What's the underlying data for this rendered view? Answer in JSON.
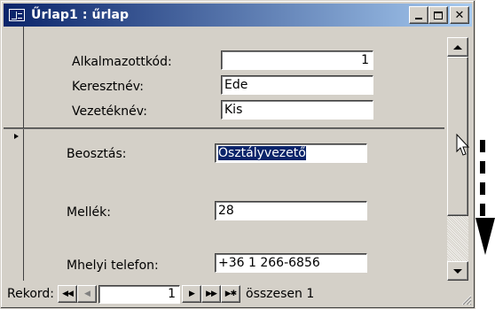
{
  "window": {
    "title": "Űrlap1 : űrlap"
  },
  "fields": [
    {
      "label": "Alkalmazottkód:",
      "value": "1"
    },
    {
      "label": "Keresztnév:",
      "value": "Ede"
    },
    {
      "label": "Vezetéknév:",
      "value": "Kis"
    },
    {
      "label": "Beosztás:",
      "value": "Osztályvezető"
    },
    {
      "label": "Mellék:",
      "value": "28"
    },
    {
      "label": "Mhelyi telefon:",
      "value": "+36 1 266-6856"
    }
  ],
  "navigation": {
    "label": "Rekord:",
    "current": "1",
    "count_text": "összesen 1",
    "first": "◀◀",
    "prev": "◀",
    "next": "▶",
    "last": "▶▶",
    "new": "▶✱"
  },
  "colors": {
    "titlebar_start": "#0a246a",
    "titlebar_end": "#a6caf0",
    "face": "#d4d0c8"
  }
}
